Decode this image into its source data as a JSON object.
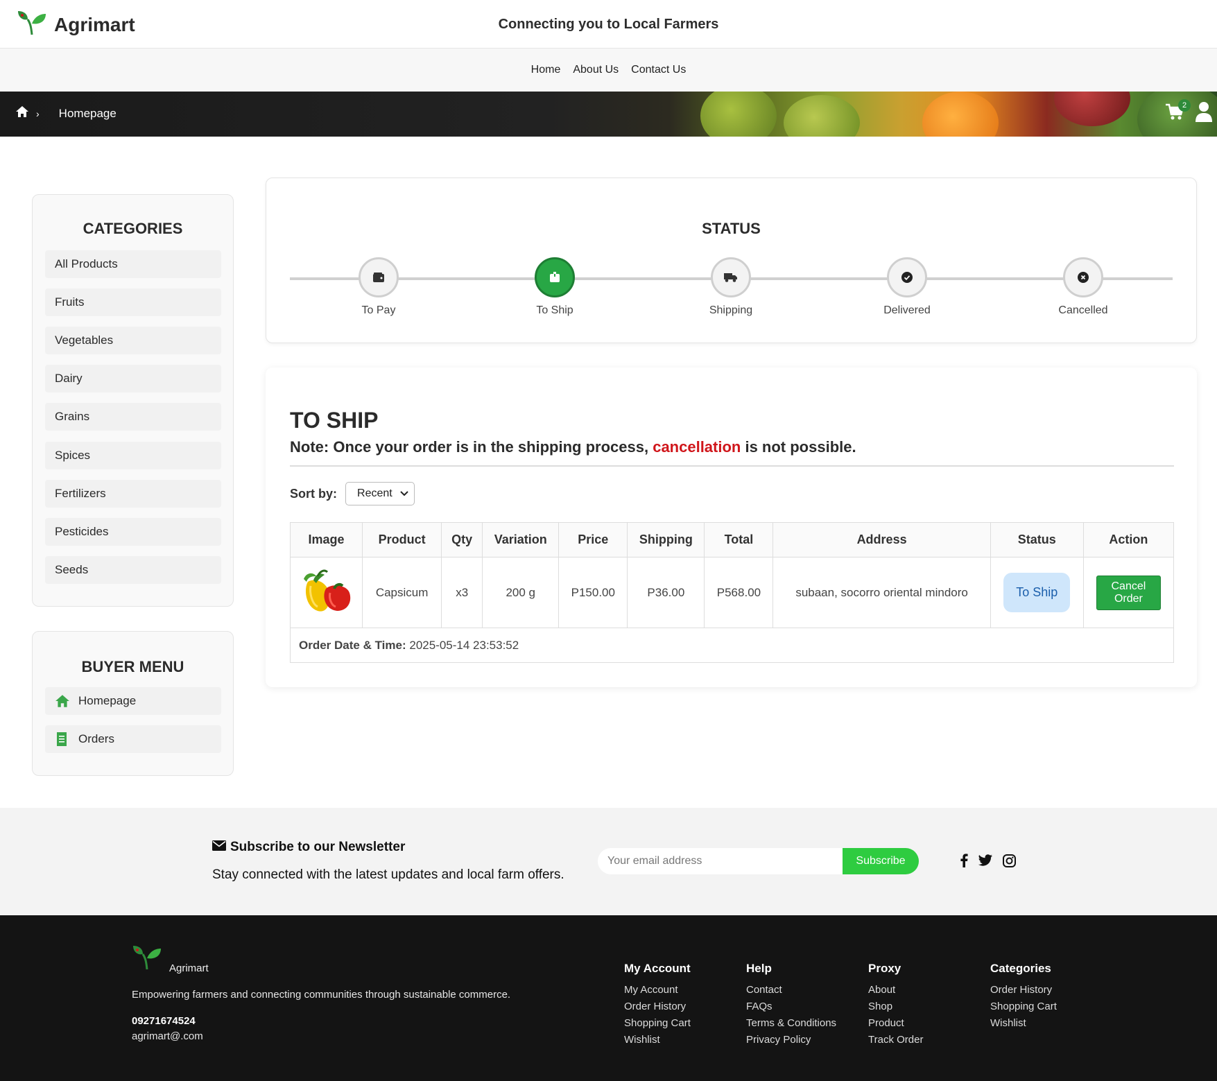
{
  "header": {
    "brand": "Agrimart",
    "tagline": "Connecting you to Local Farmers"
  },
  "nav": {
    "items": [
      "Home",
      "About Us",
      "Contact Us"
    ]
  },
  "banner": {
    "breadcrumb_sep": "›",
    "breadcrumb_current": "Homepage",
    "cart_count": "2"
  },
  "categories": {
    "title": "CATEGORIES",
    "items": [
      "All Products",
      "Fruits",
      "Vegetables",
      "Dairy",
      "Grains",
      "Spices",
      "Fertilizers",
      "Pesticides",
      "Seeds"
    ]
  },
  "buyer_menu": {
    "title": "BUYER MENU",
    "items": [
      {
        "label": "Homepage",
        "icon": "home-icon"
      },
      {
        "label": "Orders",
        "icon": "receipt-icon"
      }
    ]
  },
  "status": {
    "title": "STATUS",
    "steps": [
      {
        "label": "To Pay",
        "icon": "wallet-icon",
        "active": false
      },
      {
        "label": "To Ship",
        "icon": "box-icon",
        "active": true
      },
      {
        "label": "Shipping",
        "icon": "truck-icon",
        "active": false
      },
      {
        "label": "Delivered",
        "icon": "check-circle-icon",
        "active": false
      },
      {
        "label": "Cancelled",
        "icon": "x-circle-icon",
        "active": false
      }
    ]
  },
  "orders": {
    "heading": "TO SHIP",
    "note_before": "Note: Once your order is in the shipping process, ",
    "note_highlight": "cancellation",
    "note_after": " is not possible.",
    "sort_label": "Sort by:",
    "sort_value": "Recent",
    "columns": [
      "Image",
      "Product",
      "Qty",
      "Variation",
      "Price",
      "Shipping",
      "Total",
      "Address",
      "Status",
      "Action"
    ],
    "rows": [
      {
        "product": "Capsicum",
        "qty": "x3",
        "variation": "200 g",
        "price": "P150.00",
        "shipping": "P36.00",
        "total": "P568.00",
        "address": "subaan, socorro oriental mindoro",
        "status": "To Ship",
        "action": "Cancel Order",
        "date_label": "Order Date & Time:",
        "date_value": "2025-05-14 23:53:52"
      }
    ]
  },
  "newsletter": {
    "title": "Subscribe to our Newsletter",
    "text": "Stay connected with the latest updates and local farm offers.",
    "placeholder": "Your email address",
    "button": "Subscribe"
  },
  "footer": {
    "brand": "Agrimart",
    "description": "Empowering farmers and connecting communities through sustainable commerce.",
    "phone": "09271674524",
    "email": "agrimart@.com",
    "columns": [
      {
        "title": "My Account",
        "links": [
          "My Account",
          "Order History",
          "Shopping Cart",
          "Wishlist"
        ]
      },
      {
        "title": "Help",
        "links": [
          "Contact",
          "FAQs",
          "Terms & Conditions",
          "Privacy Policy"
        ]
      },
      {
        "title": "Proxy",
        "links": [
          "About",
          "Shop",
          "Product",
          "Track Order"
        ]
      },
      {
        "title": "Categories",
        "links": [
          "Order History",
          "Shopping Cart",
          "Wishlist"
        ]
      }
    ]
  },
  "colors": {
    "brand_green": "#28a745",
    "alert_red": "#d0161b",
    "status_pill_bg": "#cfe6fb",
    "footer_bg": "#141414"
  }
}
